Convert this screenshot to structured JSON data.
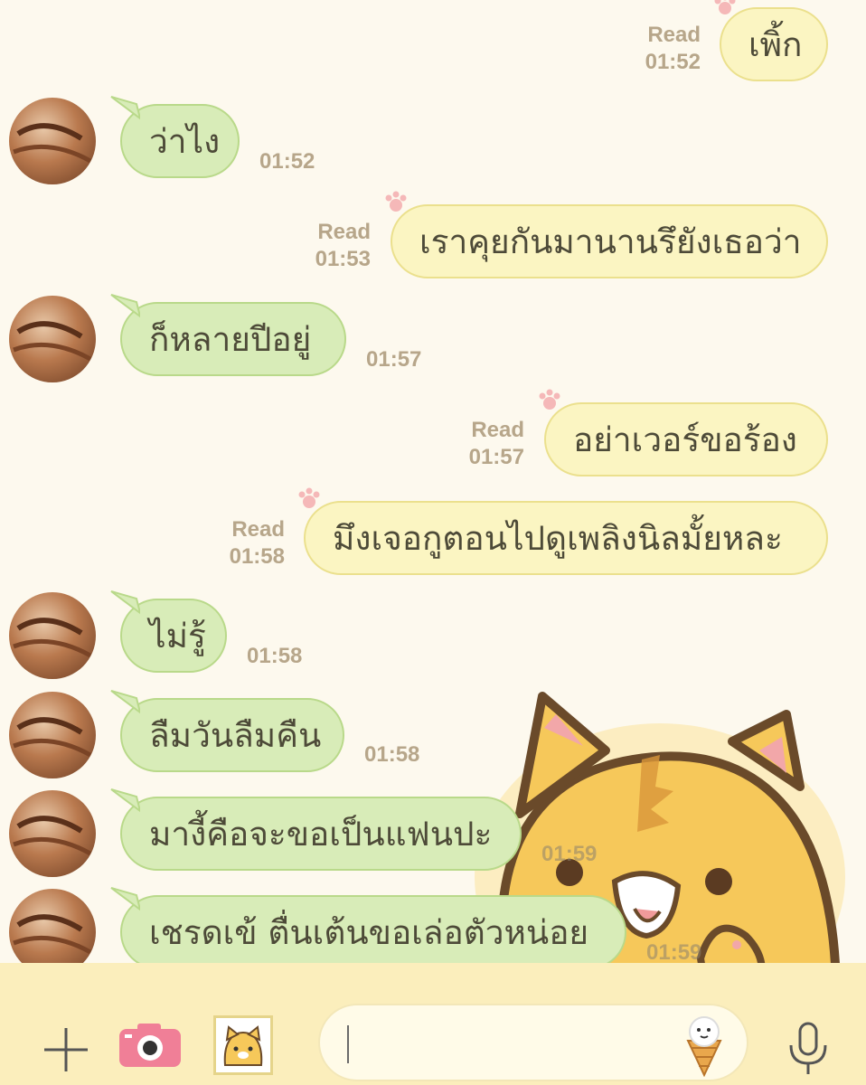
{
  "messages": [
    {
      "side": "out",
      "text": "เพิ้ก",
      "read": "Read",
      "time": "01:52"
    },
    {
      "side": "in",
      "text": "ว่าไง",
      "time": "01:52"
    },
    {
      "side": "out",
      "text": "เราคุยกันมานานรึยังเธอว่า",
      "read": "Read",
      "time": "01:53"
    },
    {
      "side": "in",
      "text": "ก็หลายปีอยู่",
      "time": "01:57"
    },
    {
      "side": "out",
      "text": "อย่าเวอร์ขอร้อง",
      "read": "Read",
      "time": "01:57"
    },
    {
      "side": "out",
      "text": "มึงเจอกูตอนไปดูเพลิงนิลมั้ยหละ",
      "read": "Read",
      "time": "01:58"
    },
    {
      "side": "in",
      "text": "ไม่รู้",
      "time": "01:58"
    },
    {
      "side": "in",
      "text": "ลืมวันลืมคืน",
      "time": "01:58"
    },
    {
      "side": "in",
      "text": "มางี้คือจะขอเป็นแฟนปะ",
      "time": "01:59"
    },
    {
      "side": "in",
      "text": "เชรดเข้ ตื่นเต้นขอเล่อตัวหน่อย",
      "time": "01:59"
    }
  ],
  "toolbar": {
    "plus_icon": "plus-icon",
    "camera_icon": "camera-icon",
    "sticker_icon": "tiger-sticker-icon",
    "emoji_icon": "ice-cream-emoji-icon",
    "mic_icon": "microphone-icon",
    "input_value": ""
  },
  "colors": {
    "background": "#fdf9ee",
    "incoming_bubble": "#d8ecb8",
    "outgoing_bubble": "#fbf5c2",
    "timestamp": "#b7a68a",
    "toolbar": "#fbeebc"
  }
}
